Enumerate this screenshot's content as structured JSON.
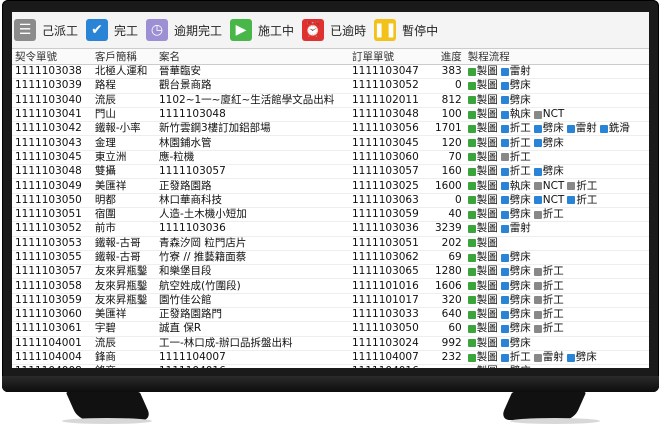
{
  "toolbar": [
    {
      "icon": "menu-icon",
      "label": "己派工",
      "color": "#8c8c8c"
    },
    {
      "icon": "check-icon",
      "label": "完工",
      "color": "#2a84d6"
    },
    {
      "icon": "clock-icon",
      "label": "逾期完工",
      "color": "#9c8fd4"
    },
    {
      "icon": "play-icon",
      "label": "施工中",
      "color": "#49b64a"
    },
    {
      "icon": "alarm-icon",
      "label": "已逾時",
      "color": "#e03131"
    },
    {
      "icon": "pause-icon",
      "label": "暫停中",
      "color": "#f2c21a"
    }
  ],
  "columns": [
    "契令單號",
    "客戶簡稱",
    "案名",
    "訂單單號",
    "進度",
    "製程流程"
  ],
  "rows": [
    {
      "id": "1111103038",
      "client": "北極人運和",
      "name": "晉華臨安",
      "order": "1111103047",
      "prog": "383",
      "tags": [
        [
          "g",
          "製圖"
        ],
        [
          "b",
          "雷射"
        ]
      ]
    },
    {
      "id": "1111103039",
      "client": "路程",
      "name": "觀台景商路",
      "order": "1111103052",
      "prog": "0",
      "tags": [
        [
          "g",
          "製圖"
        ],
        [
          "b",
          "劈床"
        ]
      ]
    },
    {
      "id": "1111103040",
      "client": "流辰",
      "name": "1102~1一~廈紅~生活館學文品出料",
      "order": "1111102011",
      "prog": "812",
      "tags": [
        [
          "g",
          "製圖"
        ],
        [
          "b",
          "劈床"
        ]
      ]
    },
    {
      "id": "1111103041",
      "client": "門山",
      "name": "1111103048",
      "order": "1111103048",
      "prog": "100",
      "tags": [
        [
          "g",
          "製圖"
        ],
        [
          "b",
          "執床"
        ],
        [
          "x",
          "NCT"
        ]
      ]
    },
    {
      "id": "1111103042",
      "client": "鐵報-小率",
      "name": "新竹雲鋼3樓訂加鋁部場",
      "order": "1111103056",
      "prog": "1701",
      "tags": [
        [
          "g",
          "製圖"
        ],
        [
          "b",
          "折工"
        ],
        [
          "b",
          "劈床"
        ],
        [
          "b",
          "雷射"
        ],
        [
          "b",
          "銑滑"
        ]
      ]
    },
    {
      "id": "1111103043",
      "client": "金理",
      "name": "林園鋪水管",
      "order": "1111103045",
      "prog": "120",
      "tags": [
        [
          "g",
          "製圖"
        ],
        [
          "b",
          "折工"
        ],
        [
          "b",
          "劈床"
        ]
      ]
    },
    {
      "id": "1111103045",
      "client": "東立洲",
      "name": "應-粒機",
      "order": "1111103060",
      "prog": "70",
      "tags": [
        [
          "g",
          "製圖"
        ],
        [
          "x",
          "折工"
        ]
      ]
    },
    {
      "id": "1111103048",
      "client": "雙攝",
      "name": "1111103057",
      "order": "1111103057",
      "prog": "160",
      "tags": [
        [
          "g",
          "製圖"
        ],
        [
          "b",
          "折工"
        ],
        [
          "b",
          "劈床"
        ]
      ]
    },
    {
      "id": "1111103049",
      "client": "美匯祥",
      "name": "正發路園路",
      "order": "1111103025",
      "prog": "1600",
      "tags": [
        [
          "g",
          "製圖"
        ],
        [
          "b",
          "執床"
        ],
        [
          "x",
          "NCT"
        ],
        [
          "x",
          "折工"
        ]
      ]
    },
    {
      "id": "1111103050",
      "client": "明都",
      "name": "林口華商科技",
      "order": "1111103063",
      "prog": "0",
      "tags": [
        [
          "g",
          "製圖"
        ],
        [
          "b",
          "劈床"
        ],
        [
          "b",
          "NCT"
        ],
        [
          "b",
          "折工"
        ]
      ]
    },
    {
      "id": "1111103051",
      "client": "宿圍",
      "name": "人造-土木機小短加",
      "order": "1111103059",
      "prog": "40",
      "tags": [
        [
          "g",
          "製圖"
        ],
        [
          "b",
          "劈床"
        ],
        [
          "x",
          "折工"
        ]
      ]
    },
    {
      "id": "1111103052",
      "client": "前市",
      "name": "1111103036",
      "order": "1111103036",
      "prog": "3239",
      "tags": [
        [
          "g",
          "製圖"
        ],
        [
          "b",
          "雷射"
        ]
      ]
    },
    {
      "id": "1111103053",
      "client": "鐵報-古哥",
      "name": "青森汐岡 粒門店片",
      "order": "1111103051",
      "prog": "202",
      "tags": [
        [
          "g",
          "製圖"
        ]
      ]
    },
    {
      "id": "1111103055",
      "client": "鐵報-古哥",
      "name": "竹寮 // 推藝籍面蔡",
      "order": "1111103062",
      "prog": "69",
      "tags": [
        [
          "g",
          "製圖"
        ],
        [
          "b",
          "劈床"
        ]
      ]
    },
    {
      "id": "1111103057",
      "client": "友來昇瓶鑿",
      "name": "和樂堡目段",
      "order": "1111103065",
      "prog": "1280",
      "tags": [
        [
          "g",
          "製圖"
        ],
        [
          "b",
          "劈床"
        ],
        [
          "x",
          "折工"
        ]
      ]
    },
    {
      "id": "1111103058",
      "client": "友來昇瓶鑿",
      "name": "航空姓成(竹圍段)",
      "order": "1111101016",
      "prog": "1606",
      "tags": [
        [
          "g",
          "製圖"
        ],
        [
          "b",
          "劈床"
        ],
        [
          "x",
          "折工"
        ]
      ]
    },
    {
      "id": "1111103059",
      "client": "友來昇瓶鑿",
      "name": "園竹佳公館",
      "order": "1111101017",
      "prog": "320",
      "tags": [
        [
          "g",
          "製圖"
        ],
        [
          "b",
          "劈床"
        ],
        [
          "x",
          "折工"
        ]
      ]
    },
    {
      "id": "1111103060",
      "client": "美匯祥",
      "name": "正發路園路門",
      "order": "1111103033",
      "prog": "640",
      "tags": [
        [
          "g",
          "製圖"
        ],
        [
          "b",
          "劈床"
        ],
        [
          "x",
          "折工"
        ]
      ]
    },
    {
      "id": "1111103061",
      "client": "宇碧",
      "name": "誠直 保R",
      "order": "1111103050",
      "prog": "60",
      "tags": [
        [
          "g",
          "製圖"
        ],
        [
          "b",
          "劈床"
        ],
        [
          "x",
          "折工"
        ]
      ]
    },
    {
      "id": "1111104001",
      "client": "流辰",
      "name": "工一-林口成-辦口品拆盤出料",
      "order": "1111103024",
      "prog": "992",
      "tags": [
        [
          "g",
          "製圖"
        ],
        [
          "b",
          "劈床"
        ]
      ]
    },
    {
      "id": "1111104004",
      "client": "鋒商",
      "name": "1111104007",
      "order": "1111104007",
      "prog": "232",
      "tags": [
        [
          "g",
          "製圖"
        ],
        [
          "b",
          "折工"
        ],
        [
          "x",
          "雷射"
        ],
        [
          "b",
          "劈床"
        ]
      ]
    },
    {
      "id": "1111104008",
      "client": "鋒商",
      "name": "1111104016",
      "order": "1111104016",
      "prog": "",
      "tags": [
        [
          "g",
          "製圖"
        ],
        [
          "b",
          "劈床"
        ]
      ]
    }
  ]
}
